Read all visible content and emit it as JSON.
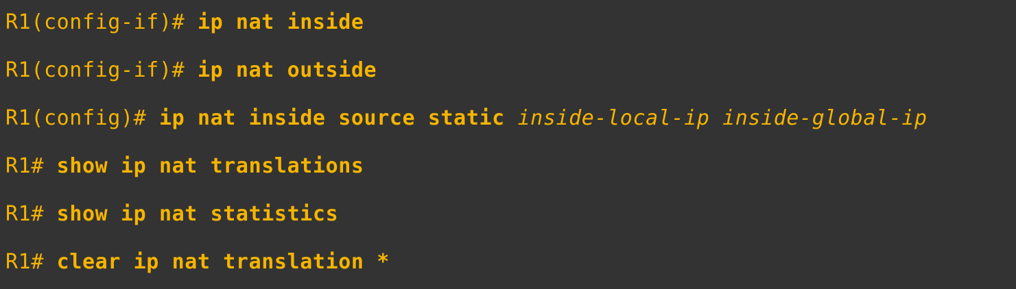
{
  "colors": {
    "background": "#333333",
    "text": "#f5b400"
  },
  "lines": [
    {
      "prompt": "R1(config-if)#",
      "command": "ip nat inside",
      "args": []
    },
    {
      "prompt": "R1(config-if)#",
      "command": "ip nat outside",
      "args": []
    },
    {
      "prompt": "R1(config)#",
      "command": "ip nat inside source static",
      "args": [
        "inside-local-ip",
        "inside-global-ip"
      ]
    },
    {
      "prompt": "R1#",
      "command": "show ip nat translations",
      "args": []
    },
    {
      "prompt": "R1#",
      "command": "show ip nat statistics",
      "args": []
    },
    {
      "prompt": "R1#",
      "command": "clear ip nat translation *",
      "args": []
    }
  ]
}
